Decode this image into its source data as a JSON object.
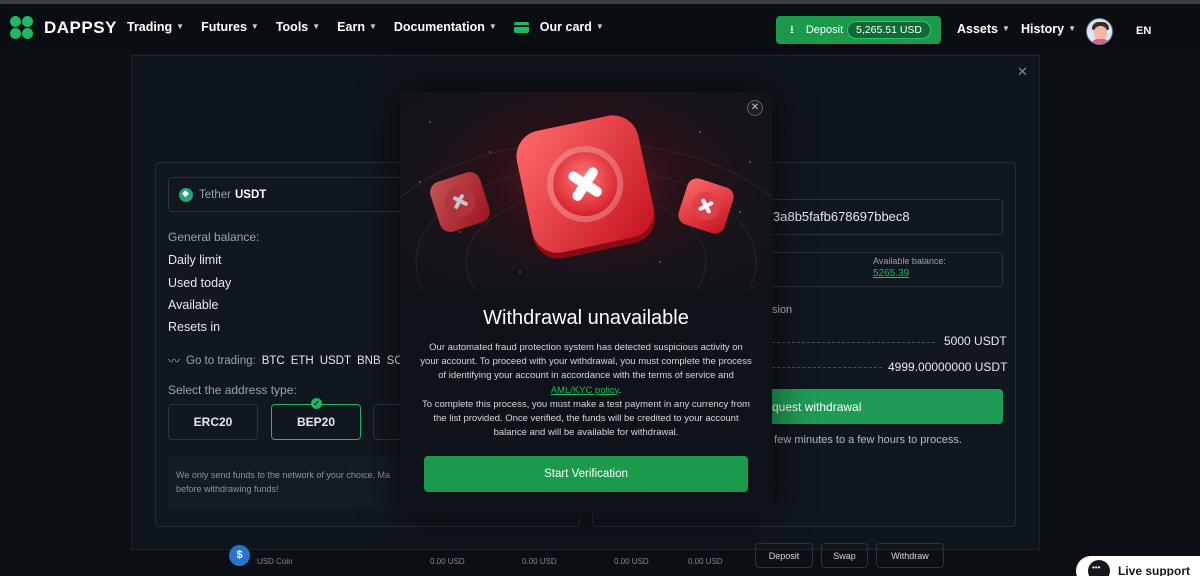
{
  "nav": {
    "brand": "DAPPSY",
    "menu": [
      "Trading",
      "Futures",
      "Tools",
      "Earn",
      "Documentation",
      "Our card"
    ],
    "deposit_label": "Deposit",
    "deposit_balance": "5,265.51 USD",
    "assets": "Assets",
    "history": "History",
    "language": "EN"
  },
  "left": {
    "token_prefix": "Tether",
    "token_name": "USDT",
    "general_balance": "General balance:",
    "rows": [
      "Daily limit",
      "Used today",
      "Available",
      "Resets in"
    ],
    "goto_label": "Go to trading:",
    "goto_coins": [
      "BTC",
      "ETH",
      "USDT",
      "BNB",
      "SO"
    ],
    "address_type_label": "Select the address type:",
    "address_types": [
      "ERC20",
      "BEP20"
    ],
    "notice": "We only send funds to the network of your choice. Ma before withdrawing funds!"
  },
  "right": {
    "address_fragment": "3a8b5fafb678697bbec8",
    "available_label": "Available balance:",
    "available_value": "5265.39",
    "fragment_text": "sion",
    "amount_1": "5000 USDT",
    "amount_2": "4999.00000000 USDT",
    "request_button": "quest withdrawal",
    "process_note": "a few minutes to a few hours to process."
  },
  "bottom": {
    "coin_label": "USD Coin",
    "zeros": [
      "0.00 USD",
      "0.00 USD",
      "0.00 USD",
      "0.00 USD"
    ],
    "actions": [
      "Deposit",
      "Swap",
      "Withdraw"
    ],
    "live_support": "Live support"
  },
  "modal": {
    "title": "Withdrawal unavailable",
    "body_1": "Our automated fraud protection system has detected suspicious activity on your account. To proceed with your withdrawal, you must complete the process of identifying your account in accordance with the terms of service and ",
    "body_link": "AML/KYC policy",
    "body_2": ".",
    "body_3": "To complete this process, you must make a test payment in any currency from the list provided. Once verified, the funds will be credited to your account balance and will be available for withdrawal.",
    "button": "Start Verification"
  }
}
